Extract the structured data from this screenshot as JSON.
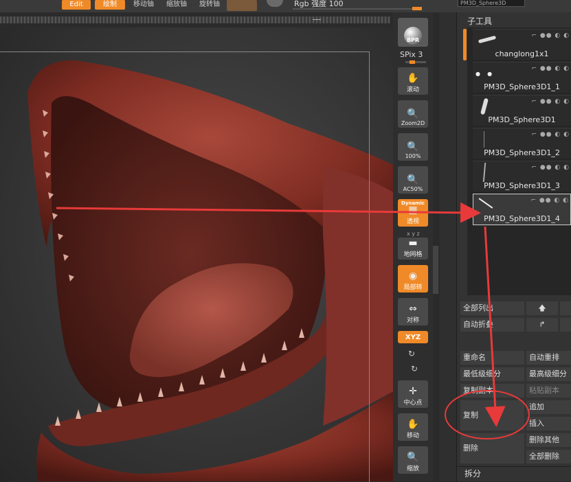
{
  "toolbar": {
    "edit_label": "Edit",
    "draw_label": "绘制",
    "move_label": "移动铀",
    "scale_label": "缩放铀",
    "rotate_label": "旋转铀",
    "rgb_intensity_label": "Rgb 强度 100",
    "subtool_name_field": "PM3D_Sphere3D"
  },
  "tools": [
    {
      "name": "bpr",
      "label": "BPR",
      "icon": "sphere-icon"
    },
    {
      "name": "spix",
      "label": "SPix 3"
    },
    {
      "name": "scroll",
      "label": "滚动",
      "icon": "hand-icon"
    },
    {
      "name": "zoom2d",
      "label": "Zoom2D",
      "icon": "magnifier-icon"
    },
    {
      "name": "100",
      "label": "100%",
      "icon": "magnifier-icon"
    },
    {
      "name": "ac50",
      "label": "AC50%",
      "icon": "magnifier-icon"
    },
    {
      "name": "perspective",
      "label": "透视",
      "sublabel": "Dynamic",
      "icon": "grid-icon"
    },
    {
      "name": "floor",
      "label": "地网格",
      "icon": "floor-icon"
    },
    {
      "name": "local",
      "label": "局部转",
      "icon": "local-icon"
    },
    {
      "name": "symmetry",
      "label": "对称",
      "icon": "symmetry-icon"
    },
    {
      "name": "xyz",
      "label": "XYZ"
    },
    {
      "name": "center",
      "label": "中心点",
      "icon": "center-icon"
    },
    {
      "name": "move",
      "label": "移动",
      "icon": "hand-icon"
    },
    {
      "name": "scale",
      "label": "缩放",
      "icon": "magnifier-icon"
    }
  ],
  "subtool": {
    "header": "子工具",
    "items": [
      {
        "name": "changlong1x1"
      },
      {
        "name": "PM3D_Sphere3D1_1"
      },
      {
        "name": "PM3D_Sphere3D1"
      },
      {
        "name": "PM3D_Sphere3D1_2"
      },
      {
        "name": "PM3D_Sphere3D1_3"
      },
      {
        "name": "PM3D_Sphere3D1_4"
      }
    ],
    "list_all": "全部列出",
    "auto_collapse": "自动折叠",
    "rename": "重命名",
    "auto_reorder": "自动重排",
    "lowest_subdiv": "最低级细分",
    "highest_subdiv": "最高级细分",
    "copy_subtool": "复制副本",
    "paste_subtool": "粘贴副本",
    "duplicate": "复制",
    "append": "追加",
    "insert": "插入",
    "delete": "删除",
    "delete_other": "删除其他",
    "delete_all": "全部删除",
    "split": "拆分"
  },
  "colors": {
    "accent": "#f08a28",
    "annotation": "#e83a3a",
    "model": "#8a2f22"
  }
}
